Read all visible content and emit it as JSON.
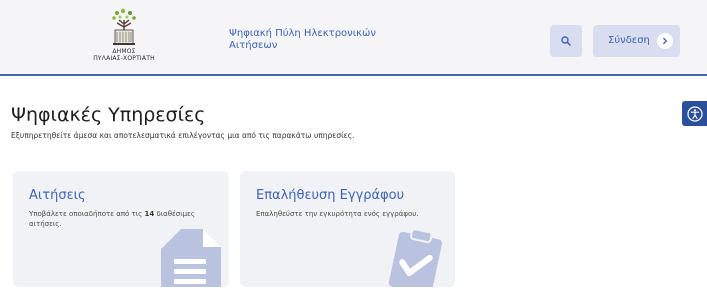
{
  "header": {
    "logo_line1": "ΔΗΜΟΣ",
    "logo_line2": "ΠΥΛΑΙΑΣ-ΧΟΡΤΙΑΤΗ",
    "portal_title_line1": "Ψηφιακή Πύλη Ηλεκτρονικών",
    "portal_title_line2": "Αιτήσεων",
    "login_label": "Σύνδεση",
    "search_icon": "search-icon",
    "login_icon": "chevron-right-icon"
  },
  "accessibility": {
    "icon": "accessibility-icon"
  },
  "main": {
    "heading": "Ψηφιακές Υπηρεσίες",
    "subtitle": "Εξυπηρετηθείτε άμεσα και αποτελεσματικά επιλέγοντας μια από τις παρακάτω υπηρεσίες.",
    "cards": [
      {
        "title": "Αιτήσεις",
        "desc_before": "Υποβάλετε οποιαδήποτε από τις ",
        "desc_count": "14",
        "desc_after": " διαθέσιμες αιτήσεις.",
        "icon": "document-icon"
      },
      {
        "title": "Επαλήθευση Εγγράφου",
        "desc": "Επαληθεύστε την εγκυρότητα ενός εγγράφου.",
        "icon": "clipboard-check-icon"
      }
    ]
  },
  "colors": {
    "brand": "#3f64b0",
    "header_bg": "#f5f5f8",
    "button_bg": "#d8def0",
    "card_bg": "#f1f2f6",
    "illustration": "#b9c3e0",
    "accessibility_bg": "#2b4f9a"
  }
}
